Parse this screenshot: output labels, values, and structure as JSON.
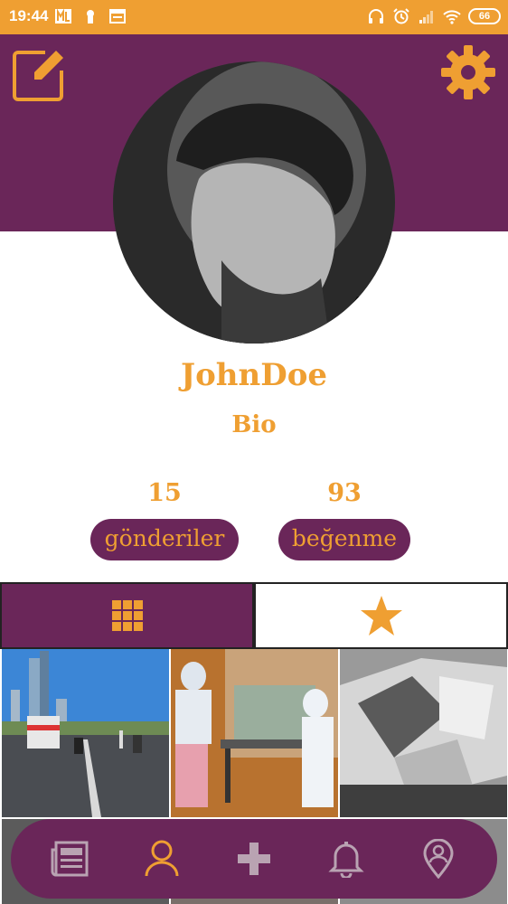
{
  "status_bar": {
    "time": "19:44",
    "battery": "66",
    "icons": [
      "ml-icon",
      "keyhole-icon",
      "window-icon",
      "headphones-icon",
      "alarm-icon",
      "signal-icon",
      "wifi-icon"
    ]
  },
  "header": {
    "edit_icon": "edit-icon",
    "settings_icon": "gear-icon"
  },
  "profile": {
    "username": "JohnDoe",
    "bio": "Bio",
    "posts_count": "15",
    "posts_label": "gönderiler",
    "likes_count": "93",
    "likes_label": "beğenme"
  },
  "tabs": [
    {
      "name": "grid",
      "icon": "grid-icon",
      "selected": true
    },
    {
      "name": "favorites",
      "icon": "star-icon",
      "selected": false
    }
  ],
  "bottom_nav": [
    {
      "name": "news",
      "icon": "newspaper-icon"
    },
    {
      "name": "profile",
      "icon": "user-icon",
      "active": true
    },
    {
      "name": "add",
      "icon": "plus-icon"
    },
    {
      "name": "notifications",
      "icon": "bell-icon"
    },
    {
      "name": "location",
      "icon": "location-icon"
    }
  ],
  "colors": {
    "accent": "#ef9f32",
    "primary": "#6a2659",
    "nav_inactive": "#b9a3b2"
  }
}
